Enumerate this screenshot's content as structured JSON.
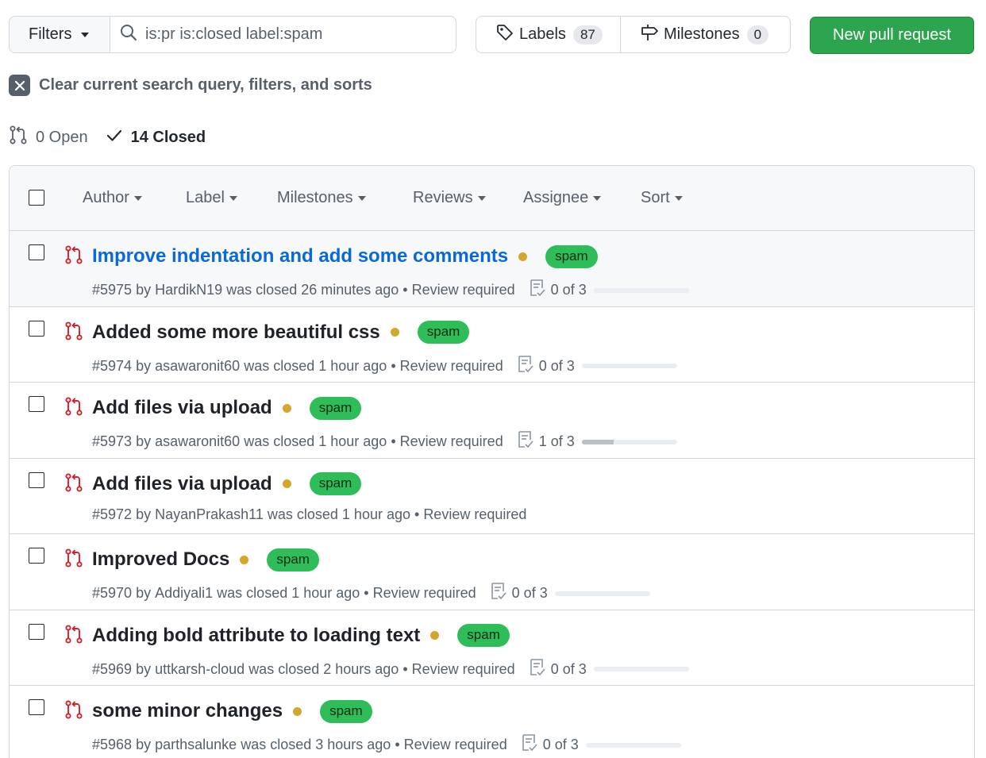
{
  "toolbar": {
    "filters_label": "Filters",
    "search_value": "is:pr is:closed label:spam",
    "labels_label": "Labels",
    "labels_count": "87",
    "milestones_label": "Milestones",
    "milestones_count": "0",
    "new_pr_label": "New pull request"
  },
  "clear_search_label": "Clear current search query, filters, and sorts",
  "states": {
    "open_label": "0 Open",
    "closed_label": "14 Closed"
  },
  "list_header": {
    "author": "Author",
    "label": "Label",
    "milestones": "Milestones",
    "reviews": "Reviews",
    "assignee": "Assignee",
    "sort": "Sort"
  },
  "colors": {
    "closed_pr_icon": "#cf222e",
    "spam_label": "#2ebd59",
    "status_pending": "#d4a72c",
    "primary_button": "#2da44e",
    "link": "#0969da"
  },
  "pull_requests": [
    {
      "title": "Improve indentation and add some comments",
      "label": "spam",
      "number": "#5975",
      "by": "by",
      "author": "HardikN19",
      "closed_text": "was closed 26 minutes ago",
      "review_status": "Review required",
      "tasks": "0 of 3",
      "tasks_done_fraction": 0
    },
    {
      "title": "Added some more beautiful css",
      "label": "spam",
      "number": "#5974",
      "by": "by",
      "author": "asawaronit60",
      "closed_text": "was closed 1 hour ago",
      "review_status": "Review required",
      "tasks": "0 of 3",
      "tasks_done_fraction": 0
    },
    {
      "title": "Add files via upload",
      "label": "spam",
      "number": "#5973",
      "by": "by",
      "author": "asawaronit60",
      "closed_text": "was closed 1 hour ago",
      "review_status": "Review required",
      "tasks": "1 of 3",
      "tasks_done_fraction": 0.333
    },
    {
      "title": "Add files via upload",
      "label": "spam",
      "number": "#5972",
      "by": "by",
      "author": "NayanPrakash11",
      "closed_text": "was closed 1 hour ago",
      "review_status": "Review required",
      "tasks": "",
      "tasks_done_fraction": null
    },
    {
      "title": "Improved Docs",
      "label": "spam",
      "number": "#5970",
      "by": "by",
      "author": "Addiyali1",
      "closed_text": "was closed 1 hour ago",
      "review_status": "Review required",
      "tasks": "0 of 3",
      "tasks_done_fraction": 0
    },
    {
      "title": "Adding bold attribute to loading text",
      "label": "spam",
      "number": "#5969",
      "by": "by",
      "author": "uttkarsh-cloud",
      "closed_text": "was closed 2 hours ago",
      "review_status": "Review required",
      "tasks": "0 of 3",
      "tasks_done_fraction": 0
    },
    {
      "title": "some minor changes",
      "label": "spam",
      "number": "#5968",
      "by": "by",
      "author": "parthsalunke",
      "closed_text": "was closed 3 hours ago",
      "review_status": "Review required",
      "tasks": "0 of 3",
      "tasks_done_fraction": 0
    }
  ]
}
